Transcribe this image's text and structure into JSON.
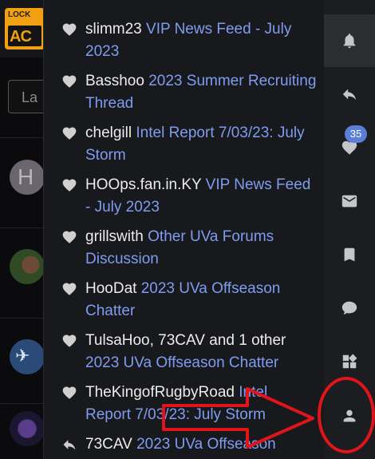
{
  "background": {
    "logo_top": "LOCK",
    "logo_big": "AC",
    "search_placeholder": "La",
    "avatar_letter": "H"
  },
  "notifications": [
    {
      "user": "slimm23",
      "title": "VIP News Feed - July 2023",
      "icon": "heart-icon"
    },
    {
      "user": "Basshoo",
      "title": "2023 Summer Recruiting Thread",
      "icon": "heart-icon"
    },
    {
      "user": "chelgill",
      "title": "Intel Report 7/03/23: July Storm",
      "icon": "heart-icon"
    },
    {
      "user": "HOOps.fan.in.KY",
      "title": "VIP News Feed - July 2023",
      "icon": "heart-icon"
    },
    {
      "user": "grillswith",
      "title": "Other UVa Forums Discussion",
      "icon": "heart-icon"
    },
    {
      "user": "HooDat",
      "title": "2023 UVa Offseason Chatter",
      "icon": "heart-icon"
    },
    {
      "user": "TulsaHoo, 73CAV and 1 other",
      "title": "2023 UVa Offseason Chatter",
      "icon": "heart-icon"
    },
    {
      "user": "TheKingofRugbyRoad",
      "title": "Intel Report 7/03/23: July Storm",
      "icon": "heart-icon"
    },
    {
      "user": "73CAV",
      "title": "2023 UVa Offseason",
      "icon": "reply-icon"
    }
  ],
  "rail": {
    "items": [
      "bell-icon",
      "reply-icon",
      "heart-icon",
      "mail-icon",
      "bookmark-icon",
      "chat-icon",
      "widgets-icon",
      "account-icon"
    ],
    "likes_badge": "35"
  },
  "colors": {
    "link": "#7f9cf0",
    "badge": "#5b7ed6",
    "annotation": "#e0141a",
    "logo": "#f0a010"
  }
}
